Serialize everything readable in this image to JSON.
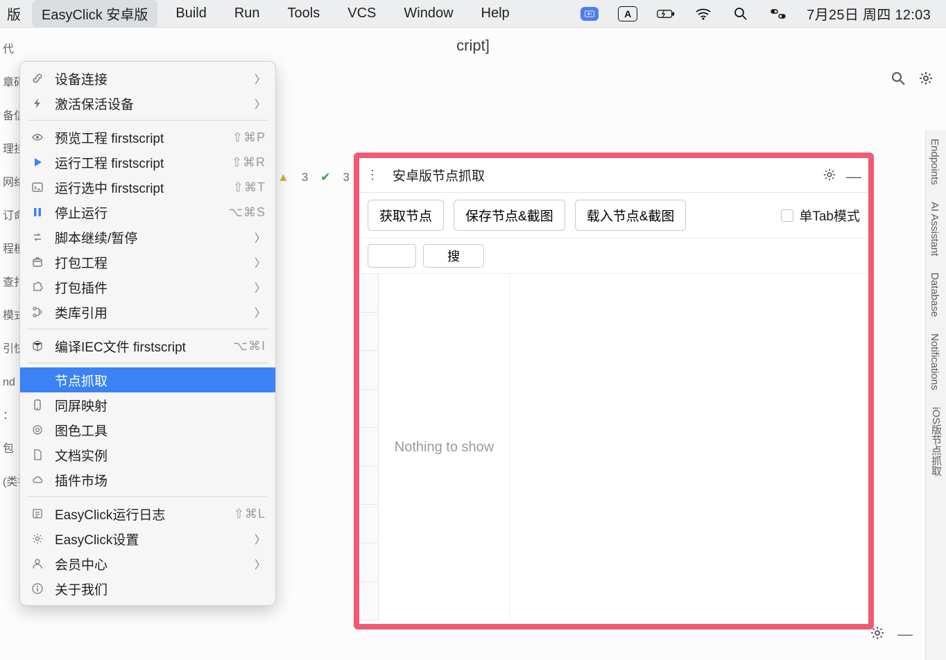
{
  "menubar": {
    "truncated": "版",
    "items": [
      "EasyClick 安卓版",
      "Build",
      "Run",
      "Tools",
      "VCS",
      "Window",
      "Help"
    ],
    "date": "7月25日 周四 12:03",
    "input_badge": "A"
  },
  "app": {
    "title_suffix": "cript]",
    "search_icon": "search",
    "settings_icon": "gear"
  },
  "dropdown": {
    "groups": [
      [
        {
          "label": "设备连接",
          "icon": "link",
          "shortcut": "",
          "submenu": true
        },
        {
          "label": "激活保活设备",
          "icon": "bolt",
          "shortcut": "",
          "submenu": true
        }
      ],
      [
        {
          "label": "预览工程 firstscript",
          "icon": "eye",
          "shortcut": "⇧⌘P"
        },
        {
          "label": "运行工程 firstscript",
          "icon": "play",
          "shortcut": "⇧⌘R"
        },
        {
          "label": "运行选中 firstscript",
          "icon": "console",
          "shortcut": "⇧⌘T"
        },
        {
          "label": "停止运行",
          "icon": "pause",
          "shortcut": "⌥⌘S"
        },
        {
          "label": "脚本继续/暂停",
          "icon": "swap",
          "shortcut": "",
          "submenu": true
        },
        {
          "label": "打包工程",
          "icon": "box",
          "shortcut": "",
          "submenu": true
        },
        {
          "label": "打包插件",
          "icon": "puzzle",
          "shortcut": "",
          "submenu": true
        },
        {
          "label": "类库引用",
          "icon": "tree",
          "shortcut": "",
          "submenu": true
        }
      ],
      [
        {
          "label": "编译IEC文件 firstscript",
          "icon": "cube",
          "shortcut": "⌥⌘I"
        }
      ],
      [
        {
          "label": "节点抓取",
          "icon": "",
          "shortcut": "",
          "highlight": true
        },
        {
          "label": "同屏映射",
          "icon": "phone",
          "shortcut": ""
        },
        {
          "label": "图色工具",
          "icon": "target",
          "shortcut": ""
        },
        {
          "label": "文档实例",
          "icon": "doc",
          "shortcut": ""
        },
        {
          "label": "插件市场",
          "icon": "cloud",
          "shortcut": ""
        }
      ],
      [
        {
          "label": "EasyClick运行日志",
          "icon": "log",
          "shortcut": "⇧⌘L"
        },
        {
          "label": "EasyClick设置",
          "icon": "gear",
          "shortcut": "",
          "submenu": true
        },
        {
          "label": "会员中心",
          "icon": "user",
          "shortcut": "",
          "submenu": true
        },
        {
          "label": "关于我们",
          "icon": "info",
          "shortcut": ""
        }
      ]
    ]
  },
  "panel": {
    "title": "安卓版节点抓取",
    "buttons": [
      "获取节点",
      "保存节点&截图",
      "载入节点&截图"
    ],
    "single_tab": "单Tab模式",
    "search_btn": "搜",
    "empty": "Nothing to show"
  },
  "rside": [
    "Endpoints",
    "AI Assistant",
    "Database",
    "Notifications",
    "iOS版节点抓取"
  ],
  "editor_hints": {
    "warnings": "3",
    "passes": "3"
  },
  "left_fog_lines": [
    "代",
    "章碍",
    "备信",
    "理挂",
    "网络",
    "订命",
    "程模",
    "查扎",
    "模式",
    "引快",
    "",
    "nd",
    "：",
    "包",
    "(类名) - 导入Java类"
  ],
  "bottom_placeholder": ""
}
